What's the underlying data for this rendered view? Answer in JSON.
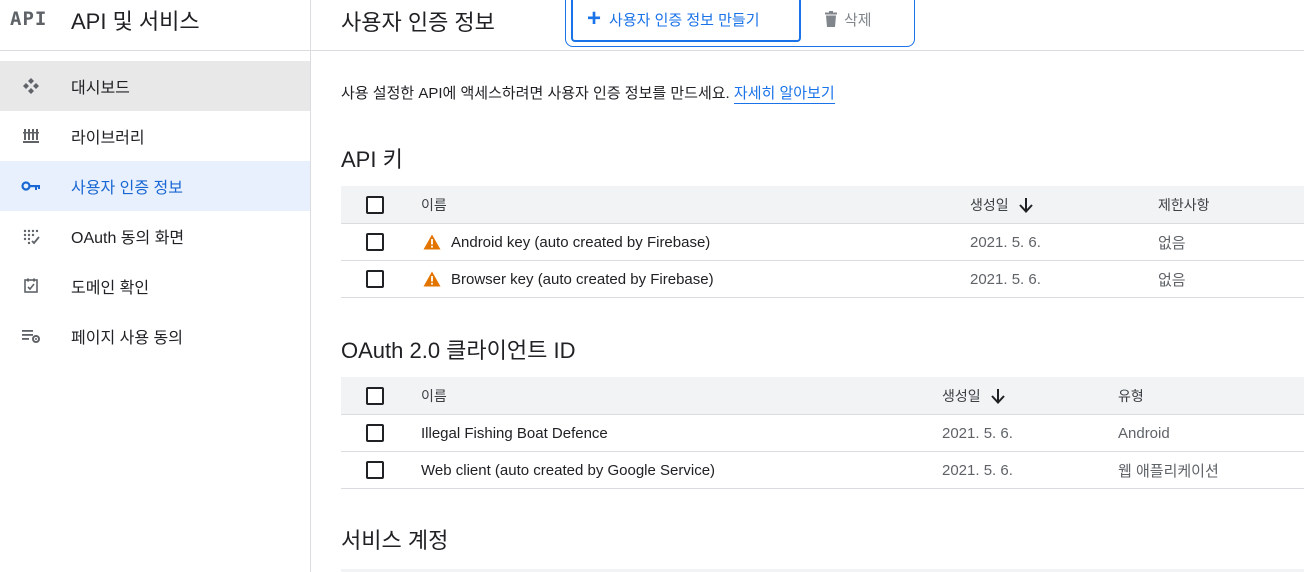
{
  "sidebar": {
    "logo": "API",
    "title": "API 및 서비스",
    "items": [
      {
        "label": "대시보드",
        "icon": "dashboard-icon"
      },
      {
        "label": "라이브러리",
        "icon": "library-icon"
      },
      {
        "label": "사용자 인증 정보",
        "icon": "key-icon"
      },
      {
        "label": "OAuth 동의 화면",
        "icon": "consent-icon"
      },
      {
        "label": "도메인 확인",
        "icon": "domain-check-icon"
      },
      {
        "label": "페이지 사용 동의",
        "icon": "page-settings-icon"
      }
    ]
  },
  "header": {
    "title": "사용자 인증 정보",
    "create_label": "사용자 인증 정보 만들기",
    "delete_label": "삭제"
  },
  "intro": {
    "text": "사용 설정한 API에 액세스하려면 사용자 인증 정보를 만드세요. ",
    "link": "자세히 알아보기"
  },
  "api_keys": {
    "title": "API 키",
    "columns": {
      "name": "이름",
      "created": "생성일",
      "restrictions": "제한사항"
    },
    "rows": [
      {
        "name": "Android key (auto created by Firebase)",
        "created": "2021. 5. 6.",
        "restrictions": "없음"
      },
      {
        "name": "Browser key (auto created by Firebase)",
        "created": "2021. 5. 6.",
        "restrictions": "없음"
      }
    ]
  },
  "oauth": {
    "title": "OAuth 2.0 클라이언트 ID",
    "columns": {
      "name": "이름",
      "created": "생성일",
      "type": "유형"
    },
    "rows": [
      {
        "name": "Illegal Fishing Boat Defence",
        "created": "2021. 5. 6.",
        "type": "Android"
      },
      {
        "name": "Web client (auto created by Google Service)",
        "created": "2021. 5. 6.",
        "type": "웹 애플리케이션"
      }
    ]
  },
  "service_accounts": {
    "title": "서비스 계정"
  },
  "colors": {
    "accent": "#1a73e8",
    "warning": "#e37400"
  }
}
